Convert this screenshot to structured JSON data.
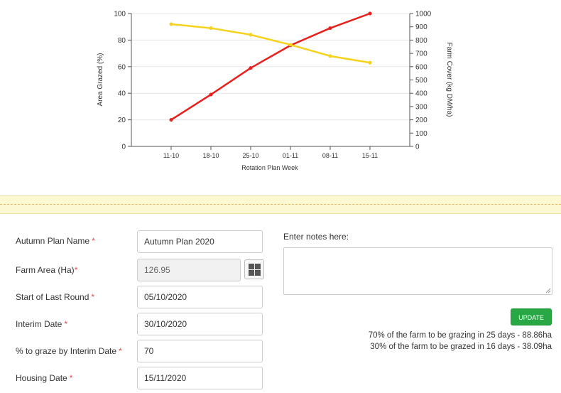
{
  "chart_data": {
    "type": "line",
    "categories": [
      "11-10",
      "18-10",
      "25-10",
      "01-11",
      "08-11",
      "15-11"
    ],
    "xlabel": "Rotation Plan Week",
    "ylabel": "Area Grazed (%)",
    "y2label": "Farm Cover (kg DM/ha)",
    "ylim": [
      0,
      100
    ],
    "y2lim": [
      0,
      1000
    ],
    "yticks": [
      "0",
      "20",
      "40",
      "60",
      "80",
      "100"
    ],
    "y2ticks": [
      "0",
      "100",
      "200",
      "300",
      "400",
      "500",
      "600",
      "700",
      "800",
      "900",
      "1000"
    ],
    "grid": "horizontal",
    "series": [
      {
        "axis": "left",
        "color": "#e8201c",
        "values": [
          20,
          39,
          59,
          76,
          89,
          100
        ]
      },
      {
        "axis": "right",
        "color": "#f5d21b",
        "values": [
          920,
          890,
          840,
          765,
          680,
          630
        ]
      }
    ]
  },
  "form": {
    "plan_name": {
      "label": "Autumn Plan Name",
      "required": "*",
      "value": "Autumn Plan 2020"
    },
    "farm_area": {
      "label": "Farm Area (Ha)",
      "required": "*",
      "value": "126.95"
    },
    "start_last_round": {
      "label": "Start of Last Round",
      "required": "*",
      "value": "05/10/2020"
    },
    "interim_date": {
      "label": "Interim Date",
      "required": "*",
      "value": "30/10/2020"
    },
    "pct_graze": {
      "label": "% to graze by Interim Date",
      "required": "*",
      "value": "70"
    },
    "housing_date": {
      "label": "Housing Date",
      "required": "*",
      "value": "15/11/2020"
    }
  },
  "farm_area_button_icon": "grid-icon",
  "notes": {
    "label": "Enter notes here:",
    "value": ""
  },
  "update_button": {
    "label": "UPDATE",
    "color": "#28a745"
  },
  "summary": {
    "line1": "70% of the farm to be grazing in 25 days - 88.86ha",
    "line2": "30% of the farm to be grazed in 16 days - 38.09ha"
  }
}
